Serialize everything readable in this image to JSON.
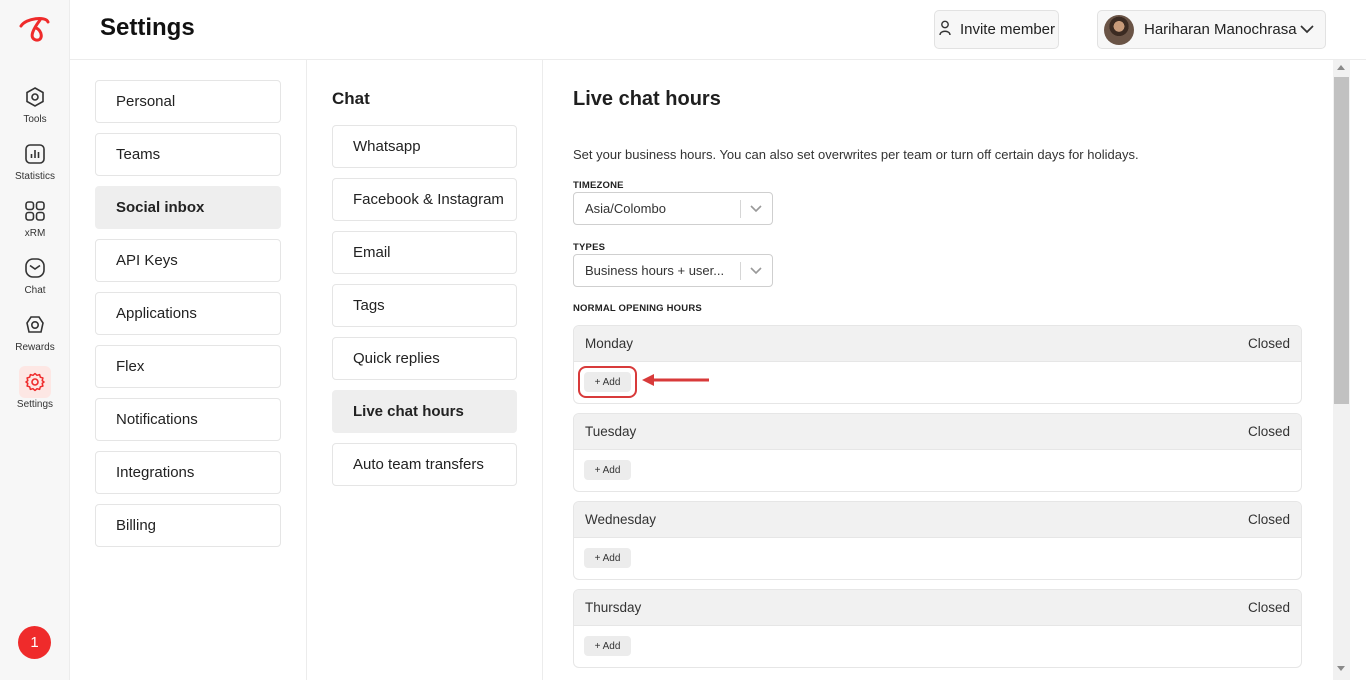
{
  "rail": {
    "items": [
      {
        "label": "Tools",
        "icon": "hexagon-tools-icon"
      },
      {
        "label": "Statistics",
        "icon": "bar-chart-icon"
      },
      {
        "label": "xRM",
        "icon": "grid-four-icon"
      },
      {
        "label": "Chat",
        "icon": "envelope-icon"
      },
      {
        "label": "Rewards",
        "icon": "rewards-badge-icon"
      },
      {
        "label": "Settings",
        "icon": "gear-icon"
      }
    ],
    "notification_count": "1",
    "accent_color": "#ef2b2b"
  },
  "header": {
    "title": "Settings",
    "invite_label": "Invite member",
    "user_name": "Hariharan Manochrasa"
  },
  "settings_nav": {
    "items": [
      {
        "label": "Personal"
      },
      {
        "label": "Teams"
      },
      {
        "label": "Social inbox"
      },
      {
        "label": "API Keys"
      },
      {
        "label": "Applications"
      },
      {
        "label": "Flex"
      },
      {
        "label": "Notifications"
      },
      {
        "label": "Integrations"
      },
      {
        "label": "Billing"
      }
    ],
    "active": "Social inbox"
  },
  "chat_nav": {
    "title": "Chat",
    "items": [
      {
        "label": "Whatsapp"
      },
      {
        "label": "Facebook & Instagram"
      },
      {
        "label": "Email"
      },
      {
        "label": "Tags"
      },
      {
        "label": "Quick replies"
      },
      {
        "label": "Live chat hours"
      },
      {
        "label": "Auto team transfers"
      }
    ],
    "active": "Live chat hours"
  },
  "main": {
    "title": "Live chat hours",
    "description": "Set your business hours. You can also set overwrites per team or turn off certain days for holidays.",
    "timezone_label": "TIMEZONE",
    "timezone_value": "Asia/Colombo",
    "types_label": "TYPES",
    "types_value": "Business hours + user...",
    "opening_hours_label": "NORMAL OPENING HOURS",
    "days": [
      {
        "name": "Monday",
        "status": "Closed",
        "add_label": "+ Add"
      },
      {
        "name": "Tuesday",
        "status": "Closed",
        "add_label": "+ Add"
      },
      {
        "name": "Wednesday",
        "status": "Closed",
        "add_label": "+ Add"
      },
      {
        "name": "Thursday",
        "status": "Closed",
        "add_label": "+ Add"
      }
    ]
  },
  "annotation": {
    "highlight_color": "#d83a3a"
  }
}
